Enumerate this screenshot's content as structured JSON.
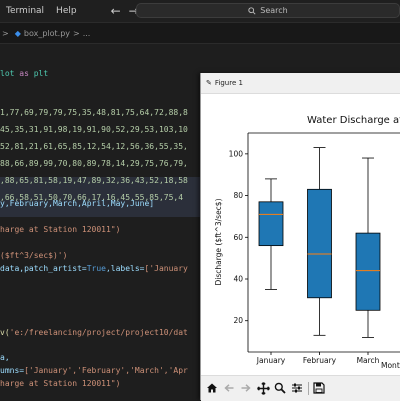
{
  "titlebar": {
    "menu": [
      "Terminal",
      "Help"
    ],
    "back_glyph": "←",
    "forward_glyph": "→",
    "search_label": "Search"
  },
  "tabbar": {
    "crumb_sep": ">",
    "file_name": "box_plot.py",
    "crumb_more": "..."
  },
  "code": {
    "l0a": "lot",
    "l0b": " as ",
    "l0c": "plt",
    "data_rows": [
      "1,77,69,79,79,75,35,48,81,75,64,72,88,8",
      "45,35,31,91,98,19,91,90,52,29,53,103,10",
      "52,81,21,61,65,85,12,54,12,56,36,55,35,",
      "88,66,89,99,70,80,89,78,14,29,75,76,79,",
      ",88,65,81,58,19,47,89,32,36,43,52,18,58",
      ",66,58,51,50,70,66,17,16,45,55,85,75,4"
    ],
    "months_line": "y,February,March,April,May,June]",
    "title_line": "harge at Station 120011\")",
    "ylabel_line": "($ft^3/sec$)')",
    "boxplot_a": "data",
    "boxplot_b": ",patch_artist=",
    "boxplot_c": "True",
    "boxplot_d": ",labels=",
    "boxplot_e": "['January",
    "readcsv_a": "v(",
    "readcsv_b": "'e:/freelancing/project/project10/dat",
    "line_a": "a,",
    "columns_a": "umns=",
    "columns_b": "['January','February','March','Apr",
    "last_line": "harge at Station 120011\")"
  },
  "figure": {
    "window_title": "Figure 1",
    "logo_glyph": "✎"
  },
  "chart_data": {
    "type": "box",
    "title": "Water Discharge at",
    "ylabel": "Discharge ($ft^3/sec$)",
    "xlabel": "Mont",
    "categories": [
      "January",
      "February",
      "March"
    ],
    "ylim": [
      5,
      110
    ],
    "yticks": [
      20,
      40,
      60,
      80,
      100
    ],
    "boxes": [
      {
        "whislo": 35,
        "q1": 56,
        "med": 71,
        "q3": 77,
        "whishi": 88
      },
      {
        "whislo": 13,
        "q1": 31,
        "med": 52,
        "q3": 83,
        "whishi": 103
      },
      {
        "whislo": 12,
        "q1": 25,
        "med": 44,
        "q3": 62,
        "whishi": 98
      }
    ],
    "box_color": "#1f77b4",
    "median_color": "#ff7f0e"
  }
}
